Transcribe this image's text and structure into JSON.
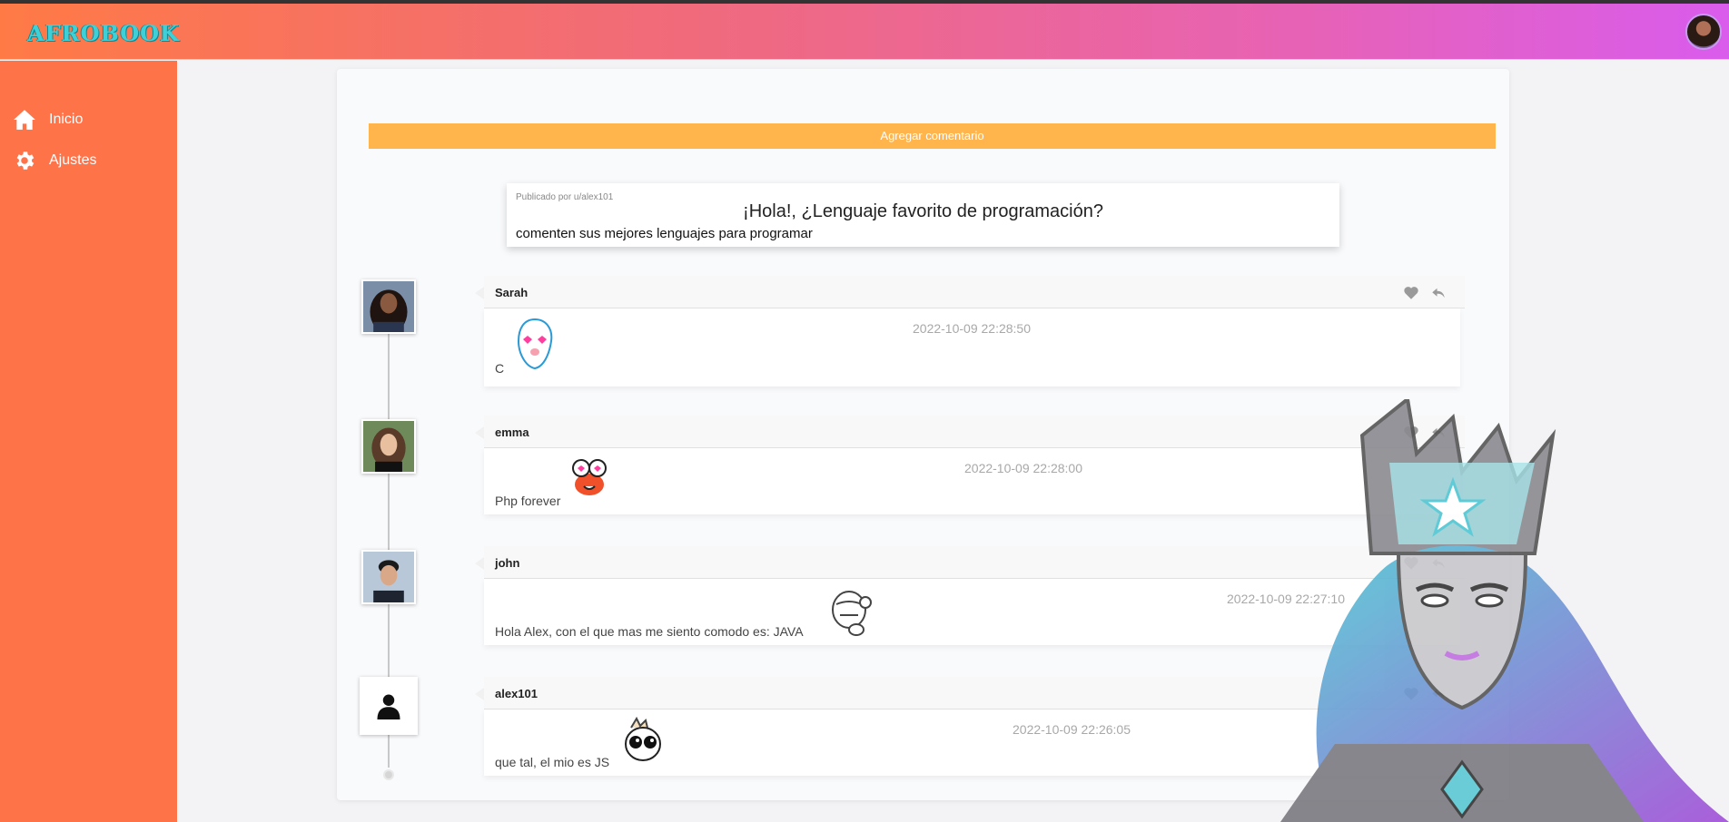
{
  "header": {
    "logo": "AFROBOOK"
  },
  "sidebar": {
    "items": [
      {
        "label": "Inicio",
        "icon": "home-icon"
      },
      {
        "label": "Ajustes",
        "icon": "gear-icon"
      }
    ]
  },
  "main": {
    "add_comment_label": "Agregar comentario",
    "post": {
      "published_by": "Publicado por u/alex101",
      "title": "¡Hola!, ¿Lenguaje favorito de programación?",
      "body": "comenten sus mejores lenguajes para programar"
    },
    "comments": [
      {
        "author": "Sarah",
        "date": "2022-10-09 22:28:50",
        "text": "C",
        "sticker": "love-eyes-sticker"
      },
      {
        "author": "emma",
        "date": "2022-10-09 22:28:00",
        "text": "Php forever",
        "sticker": "crab-sticker"
      },
      {
        "author": "john",
        "date": "2022-10-09 22:27:10",
        "text": "Hola Alex, con el que mas me siento comodo es: JAVA",
        "sticker": "thinking-sticker"
      },
      {
        "author": "alex101",
        "date": "2022-10-09 22:26:05",
        "text": "que tal, el mio es JS",
        "sticker": "cute-eyes-sticker"
      }
    ]
  },
  "colors": {
    "sidebar": "#ff7349",
    "button": "#ffb54c",
    "header_start": "#ff7a45",
    "header_end": "#d95cec"
  }
}
